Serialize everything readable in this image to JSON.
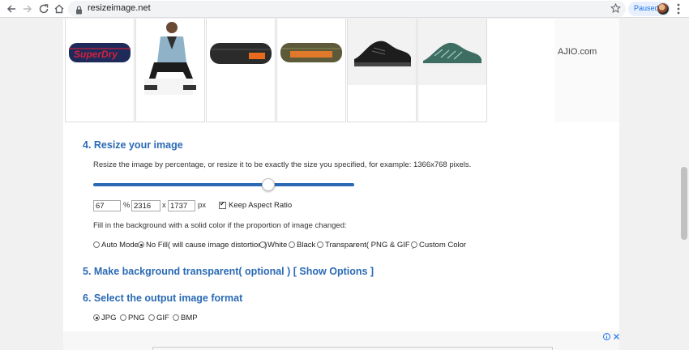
{
  "browser": {
    "url": "resizeimage.net",
    "profile_status": "Paused"
  },
  "gallery": {
    "thumbnails": [
      {
        "name": "superdry-pencil-case",
        "brand_text": "SuperDry"
      },
      {
        "name": "man-denim-jacket"
      },
      {
        "name": "black-pouch"
      },
      {
        "name": "olive-pencil-case"
      },
      {
        "name": "black-sneaker"
      },
      {
        "name": "green-sneaker"
      }
    ],
    "ad_text": "AJIO.com"
  },
  "section4": {
    "heading": "4. Resize your image",
    "description": "Resize the image by percentage, or resize it to be exactly the size you specified, for example: 1366x768 pixels.",
    "slider_value_percent": 67,
    "percent_value": "67",
    "percent_unit": "%",
    "width_value": "2316",
    "times": "x",
    "height_value": "1737",
    "px_unit": "px",
    "keep_aspect_label": "Keep Aspect Ratio",
    "keep_aspect_checked": true,
    "fill_text": "Fill in the background with a solid color if the proportion of image changed:",
    "fill_options": [
      {
        "label": "Auto Mode",
        "checked": false
      },
      {
        "label": "No Fill( will cause image distortion )",
        "checked": true
      },
      {
        "label": "White",
        "checked": false
      },
      {
        "label": "Black",
        "checked": false
      },
      {
        "label": "Transparent( PNG & GIF )",
        "checked": false
      },
      {
        "label": "Custom Color",
        "checked": false
      }
    ]
  },
  "section5": {
    "heading": "5. Make background transparent( optional )",
    "link": "[ Show Options ]"
  },
  "section6": {
    "heading": "6. Select the output image format",
    "formats": [
      {
        "label": "JPG",
        "checked": true
      },
      {
        "label": "PNG",
        "checked": false
      },
      {
        "label": "GIF",
        "checked": false
      },
      {
        "label": "BMP",
        "checked": false
      }
    ]
  },
  "ad_choices": {
    "info_icon": "info-icon",
    "close_icon": "close-icon"
  },
  "colors": {
    "heading_blue": "#2a6ab5",
    "slider_blue": "#2a6ab5"
  }
}
